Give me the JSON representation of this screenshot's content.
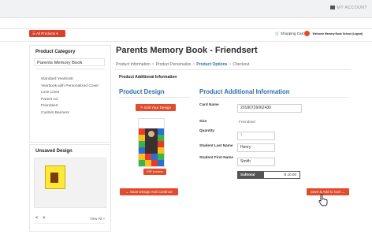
{
  "header": {
    "account_label": "MY ACCOUNT",
    "all_products_label": "All Products ▾",
    "cart_label": "Shopping Cart",
    "welcome_text": "Welcome Memory Book School (Logout)"
  },
  "sidebar": {
    "title": "Product Category",
    "selected": "Parents Memory Book",
    "items": [
      "Standard Yearbook",
      "Yearbook with Personalized Cover",
      "Love Lines",
      "Parent Ad",
      "Friendsert",
      "Custom Banners"
    ]
  },
  "unsaved": {
    "title": "Unsaved Design",
    "prev": "<",
    "next": ">",
    "view_all": "View All »"
  },
  "main": {
    "title": "Parents Memory Book - Friendsert",
    "breadcrumbs": [
      "Product Information",
      "Product Personalize",
      "Product Options",
      "Checkout"
    ],
    "section_heading": "Product Additional Information",
    "design_title": "Product Design",
    "edit_design": "✎ Edit Your Design",
    "pdf_preview": "PDF preview",
    "save_design": "← Save Design And Continue",
    "info_title": "Product Additional Information",
    "card_name_label": "Card Name",
    "card_name_value": "20180726062439",
    "size_label": "Size",
    "size_value": "Friendsert",
    "quantity_label": "Quantity",
    "quantity_value": "1",
    "last_name_label": "Student Last Name",
    "last_name_value": "Henry",
    "first_name_label": "Student First Name",
    "first_name_value": "Smith",
    "subtotal_label": "Subtotal",
    "subtotal_value": "$ 10.00",
    "add_to_cart": "Save & Add to Cart →"
  },
  "colors": {
    "accent": "#e34b2e",
    "link": "#2f6fa8"
  }
}
